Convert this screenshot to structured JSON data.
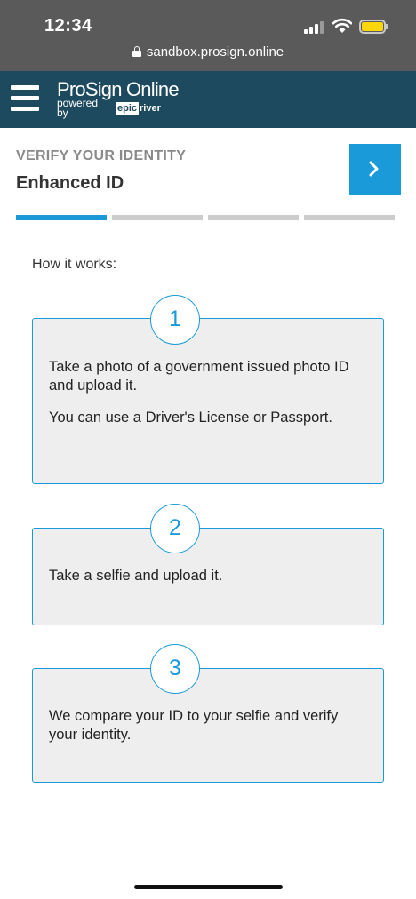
{
  "status_bar": {
    "time": "12:34",
    "url": "sandbox.prosign.online",
    "battery_color": "#ffd60a"
  },
  "header": {
    "brand": "ProSign Online",
    "powered_by": "powered by",
    "logo_left": "epic",
    "logo_right": "river",
    "menu_icon": "hamburger-menu-icon",
    "background": "#1e4a5f"
  },
  "page": {
    "kicker": "VERIFY YOUR IDENTITY",
    "title": "Enhanced ID",
    "next_icon": "chevron-right-icon",
    "accent": "#1a9ad9",
    "progress": {
      "current_step": 1,
      "total_steps": 4
    },
    "intro": "How it works:"
  },
  "steps": [
    {
      "number": "1",
      "text": "Take a photo of a government issued photo ID and upload it.",
      "note": "You can use a Driver's License or Passport."
    },
    {
      "number": "2",
      "text": "Take a selfie and upload it."
    },
    {
      "number": "3",
      "text": "We compare your ID to your selfie and verify your identity."
    }
  ]
}
